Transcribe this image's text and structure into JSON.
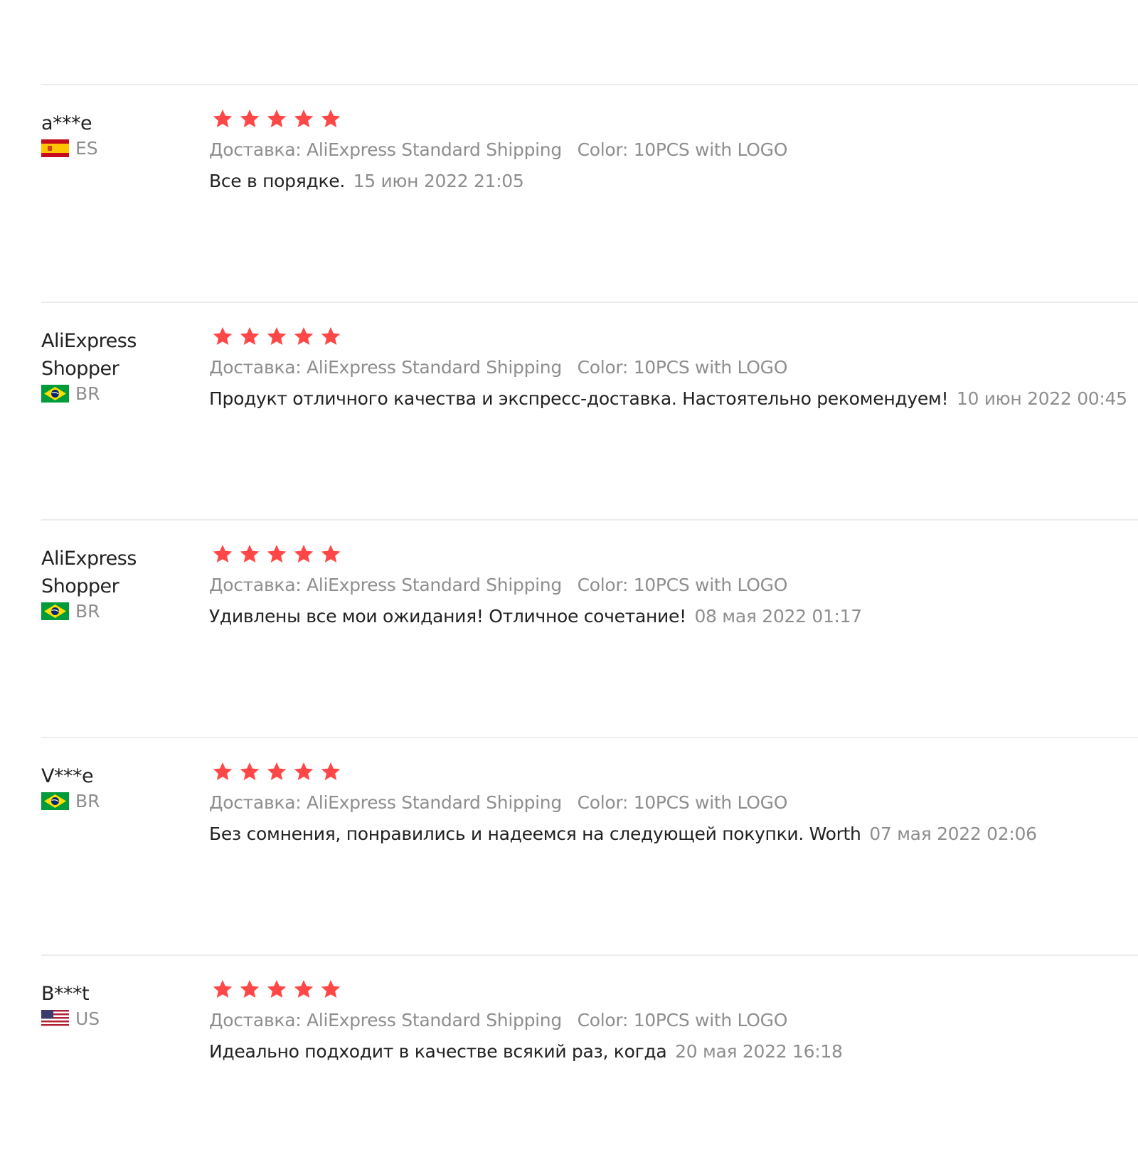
{
  "colors": {
    "star": "#ff4747",
    "text_primary": "#222222",
    "text_secondary": "#8e8e8e",
    "divider": "#ececec"
  },
  "reviews": [
    {
      "user": "a***e",
      "country": "ES",
      "flag_icon": "spain-flag-icon",
      "rating": 5,
      "shipping_label": "Доставка:",
      "shipping_value": "AliExpress Standard Shipping",
      "color_label": "Color:",
      "color_value": "10PCS with LOGO",
      "comment": "Все в порядке.",
      "date": "15 июн 2022 21:05"
    },
    {
      "user": "AliExpress Shopper",
      "country": "BR",
      "flag_icon": "brazil-flag-icon",
      "rating": 5,
      "shipping_label": "Доставка:",
      "shipping_value": "AliExpress Standard Shipping",
      "color_label": "Color:",
      "color_value": "10PCS with LOGO",
      "comment": "Продукт отличного качества и экспресс-доставка. Настоятельно рекомендуем!",
      "date": "10 июн 2022 00:45"
    },
    {
      "user": "AliExpress Shopper",
      "country": "BR",
      "flag_icon": "brazil-flag-icon",
      "rating": 5,
      "shipping_label": "Доставка:",
      "shipping_value": "AliExpress Standard Shipping",
      "color_label": "Color:",
      "color_value": "10PCS with LOGO",
      "comment": "Удивлены все мои ожидания! Отличное сочетание!",
      "date": "08 мая 2022 01:17"
    },
    {
      "user": "V***e",
      "country": "BR",
      "flag_icon": "brazil-flag-icon",
      "rating": 5,
      "shipping_label": "Доставка:",
      "shipping_value": "AliExpress Standard Shipping",
      "color_label": "Color:",
      "color_value": "10PCS with LOGO",
      "comment": "Без сомнения, понравились и надеемся на следующей покупки. Worth",
      "date": "07 мая 2022 02:06"
    },
    {
      "user": "B***t",
      "country": "US",
      "flag_icon": "usa-flag-icon",
      "rating": 5,
      "shipping_label": "Доставка:",
      "shipping_value": "AliExpress Standard Shipping",
      "color_label": "Color:",
      "color_value": "10PCS with LOGO",
      "comment": "Идеально подходит в качестве всякий раз, когда",
      "date": "20 мая 2022 16:18"
    }
  ]
}
